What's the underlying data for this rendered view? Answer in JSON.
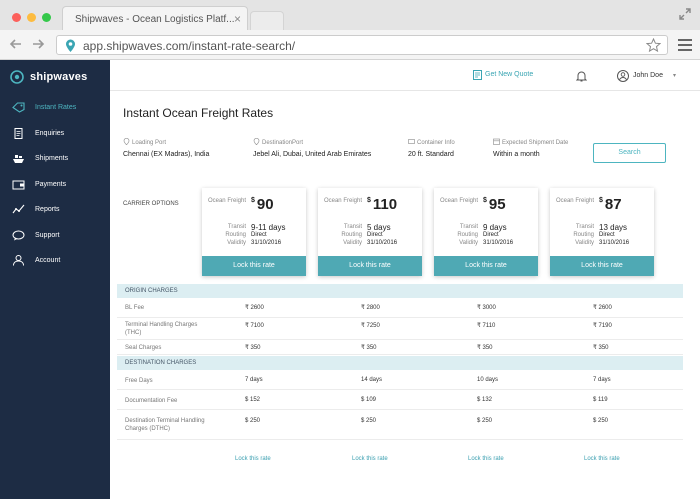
{
  "browser": {
    "tab_title": "Shipwaves - Ocean Logistics Platf...",
    "tab_close": "×",
    "url": "app.shipwaves.com/instant-rate-search/"
  },
  "brand": {
    "name": "shipwaves",
    "accent": "#4db5c0",
    "sidebar_bg": "#1d2c44"
  },
  "sidebar": {
    "items": [
      {
        "label": "Instant Rates",
        "icon": "tag-icon",
        "active": true
      },
      {
        "label": "Enquiries",
        "icon": "document-icon"
      },
      {
        "label": "Shipments",
        "icon": "ship-icon"
      },
      {
        "label": "Payments",
        "icon": "wallet-icon"
      },
      {
        "label": "Reports",
        "icon": "chart-icon"
      },
      {
        "label": "Support",
        "icon": "chat-icon"
      },
      {
        "label": "Account",
        "icon": "user-icon"
      }
    ]
  },
  "header": {
    "new_quote": "Get New Quote",
    "user_name": "John Doe",
    "caret": "▾"
  },
  "page": {
    "title": "Instant Ocean Freight Rates"
  },
  "search": {
    "loading_port": {
      "label": "Loading Port",
      "value": "Chennai (EX Madras), India"
    },
    "destination_port": {
      "label": "DestinationPort",
      "value": "Jebel Ali, Dubai, United Arab Emirates"
    },
    "container": {
      "label": "Container Info",
      "value": "20 ft. Standard"
    },
    "shipment_date": {
      "label": "Expected Shipment Date",
      "value": "Within a month"
    },
    "button": "Search"
  },
  "carriers": {
    "label": "CARRIER OPTIONS",
    "labels": {
      "freight": "Ocean Freight",
      "transit": "Transit",
      "routing": "Routing",
      "validity": "Validity",
      "currency": "$",
      "lock": "Lock this rate"
    },
    "cards": [
      {
        "price": "90",
        "transit": "9-11 days",
        "routing": "Direct",
        "validity": "31/10/2016"
      },
      {
        "price": "110",
        "transit": "5 days",
        "routing": "Direct",
        "validity": "31/10/2016"
      },
      {
        "price": "95",
        "transit": "9 days",
        "routing": "Direct",
        "validity": "31/10/2016"
      },
      {
        "price": "87",
        "transit": "13 days",
        "routing": "Direct",
        "validity": "31/10/2016"
      }
    ]
  },
  "origin": {
    "title": "ORIGIN CHARGES",
    "rows": [
      {
        "label": "BL Fee",
        "values": [
          "₹ 2600",
          "₹ 2800",
          "₹ 3000",
          "₹ 2600"
        ]
      },
      {
        "label": "Terminal Handling Charges (THC)",
        "values": [
          "₹ 7100",
          "₹ 7250",
          "₹ 7110",
          "₹ 7190"
        ]
      },
      {
        "label": "Seal Charges",
        "values": [
          "₹ 350",
          "₹ 350",
          "₹ 350",
          "₹ 350"
        ]
      }
    ]
  },
  "destination": {
    "title": "DESTINATION CHARGES",
    "rows": [
      {
        "label": "Free Days",
        "values": [
          "7 days",
          "14 days",
          "10 days",
          "7 days"
        ]
      },
      {
        "label": "Documentation Fee",
        "values": [
          "$ 152",
          "$ 109",
          "$ 132",
          "$ 119"
        ]
      },
      {
        "label": "Destination Terminal Handling Charges (DTHC)",
        "values": [
          "$ 250",
          "$ 250",
          "$ 250",
          "$ 250"
        ]
      }
    ]
  },
  "bottom_lock": "Lock this rate"
}
